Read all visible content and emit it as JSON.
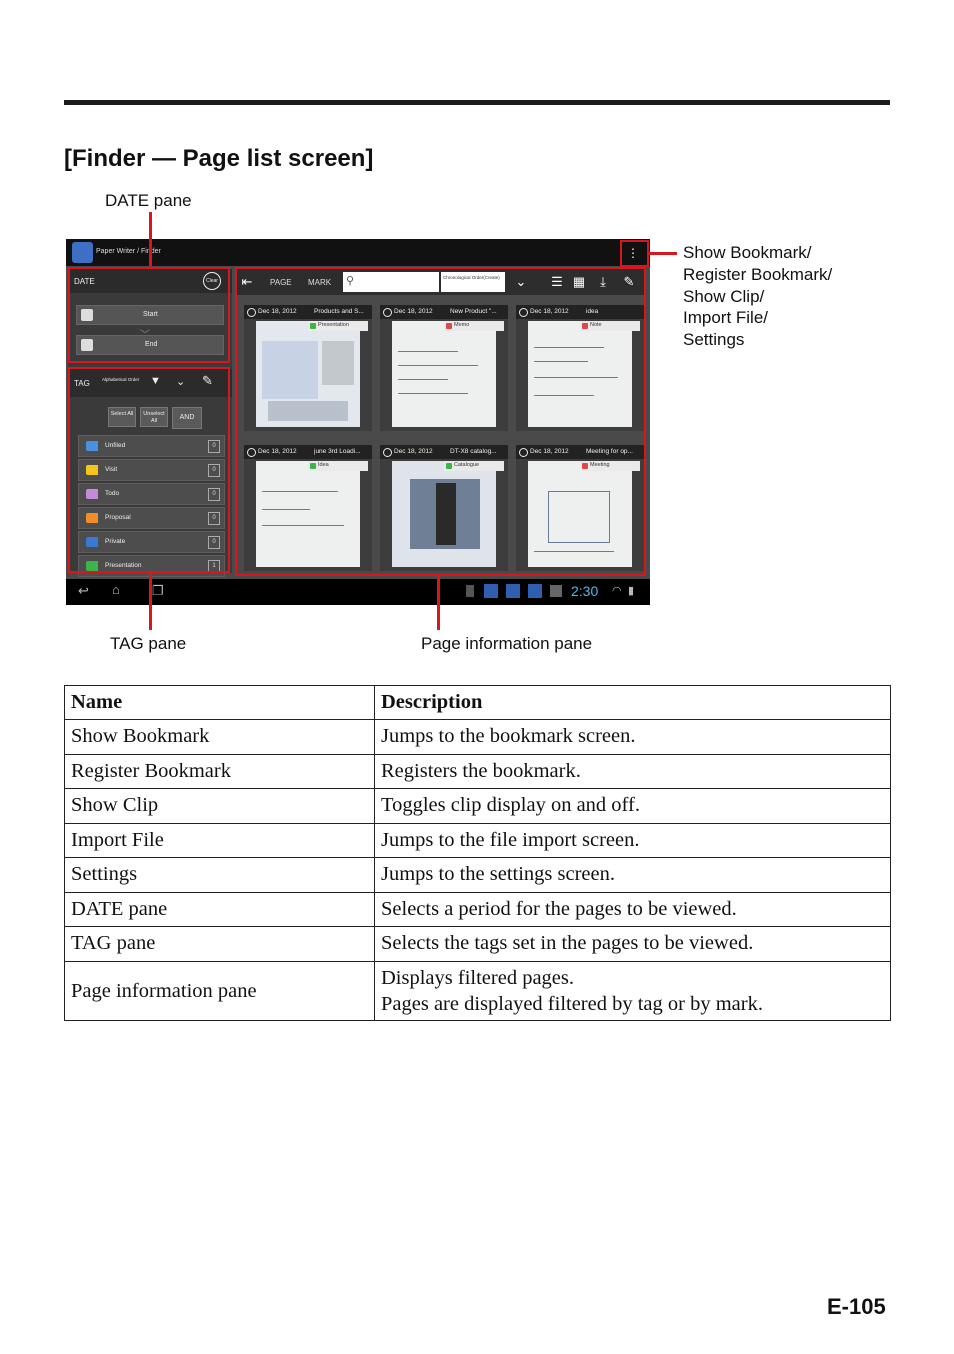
{
  "heading": "[Finder — Page list screen]",
  "callouts": {
    "date_pane": "DATE pane",
    "tag_pane": "TAG pane",
    "page_info_pane": "Page information pane",
    "menu_lines": [
      "Show Bookmark/",
      "Register Bookmark/",
      "Show Clip/",
      "Import File/",
      "Settings"
    ]
  },
  "screenshot": {
    "app_title": "Paper Writer / Finder",
    "date_pane": {
      "label": "DATE",
      "clear_label": "Clear",
      "start_label": "Start",
      "end_label": "End"
    },
    "tag_pane": {
      "label": "TAG",
      "sort_label": "Alphabetical Order",
      "select_all": "Select All",
      "unselect_all": "Unselect All",
      "and_label": "AND",
      "tags": [
        {
          "name": "Unfiled",
          "count": "0",
          "color": "#4a90e2"
        },
        {
          "name": "Visit",
          "count": "0",
          "color": "#f5c518"
        },
        {
          "name": "Todo",
          "count": "0",
          "color": "#c58ad8"
        },
        {
          "name": "Proposal",
          "count": "0",
          "color": "#f28c28"
        },
        {
          "name": "Private",
          "count": "0",
          "color": "#3a78d6"
        },
        {
          "name": "Presentation",
          "count": "1",
          "color": "#3bb54a"
        }
      ]
    },
    "toolbar": {
      "tab_page": "PAGE",
      "tab_mark": "MARK",
      "order_label": "Chronological Order(Create)"
    },
    "cards": [
      {
        "date": "Dec 18, 2012",
        "title": "Products and S...",
        "tag": "Presentation",
        "tag_color": "#3bb54a"
      },
      {
        "date": "Dec 18, 2012",
        "title": "New Product \"...",
        "tag": "Memo",
        "tag_color": "#e04646"
      },
      {
        "date": "Dec 18, 2012",
        "title": "idea",
        "tag": "Note",
        "tag_color": "#e04646"
      },
      {
        "date": "Dec 18, 2012",
        "title": "june 3rd Loadi...",
        "tag": "Idea",
        "tag_color": "#3bb54a"
      },
      {
        "date": "Dec 18, 2012",
        "title": "DT-X8 catalog...",
        "tag": "Catalogue",
        "tag_color": "#3bb54a"
      },
      {
        "date": "Dec 18, 2012",
        "title": "Meeting for op...",
        "tag": "Meeting",
        "tag_color": "#e04646"
      }
    ],
    "clock": "2:30"
  },
  "table": {
    "headers": [
      "Name",
      "Description"
    ],
    "rows": [
      {
        "name": "Show Bookmark",
        "description": [
          "Jumps to the bookmark screen."
        ]
      },
      {
        "name": "Register Bookmark",
        "description": [
          "Registers the bookmark."
        ]
      },
      {
        "name": "Show Clip",
        "description": [
          "Toggles clip display on and off."
        ]
      },
      {
        "name": "Import File",
        "description": [
          "Jumps to the file import screen."
        ]
      },
      {
        "name": "Settings",
        "description": [
          "Jumps to the settings screen."
        ]
      },
      {
        "name": "DATE pane",
        "description": [
          "Selects a period for the pages to be viewed."
        ]
      },
      {
        "name": "TAG pane",
        "description": [
          "Selects the tags set in the pages to be viewed."
        ]
      },
      {
        "name": "Page information pane",
        "description": [
          "Displays filtered pages.",
          "Pages are displayed filtered by tag or by mark."
        ]
      }
    ]
  },
  "page_number": "E-105"
}
